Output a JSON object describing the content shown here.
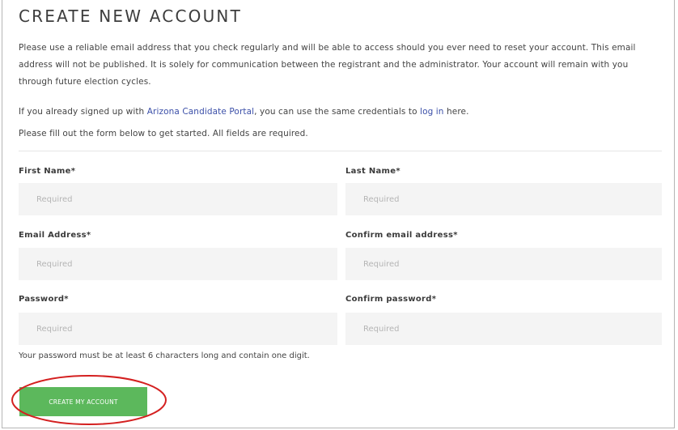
{
  "page": {
    "title": "CREATE NEW ACCOUNT",
    "intro": "Please use a reliable email address that you check regularly and will be able to access should you ever need to reset your account. This email address will not be published. It is solely for communication between the registrant and the administrator. Your account will remain with you through future election cycles.",
    "signed_up_prefix": "If you already signed up with ",
    "portal_link": "Arizona Candidate Portal",
    "signed_up_middle": ", you can use the same credentials to ",
    "login_link": "log in",
    "signed_up_suffix": " here.",
    "instructions": "Please fill out the form below to get started. All fields are required."
  },
  "form": {
    "first_name_label": "First Name*",
    "last_name_label": "Last Name*",
    "email_label": "Email Address*",
    "confirm_email_label": "Confirm email address*",
    "password_label": "Password*",
    "confirm_password_label": "Confirm password*",
    "placeholder": "Required",
    "password_hint": "Your password must be at least 6 characters long and contain one digit.",
    "submit_label": "CREATE MY ACCOUNT"
  },
  "colors": {
    "button": "#5cb85c",
    "link": "#3b4fa8",
    "annotation_ring": "#d42020"
  }
}
